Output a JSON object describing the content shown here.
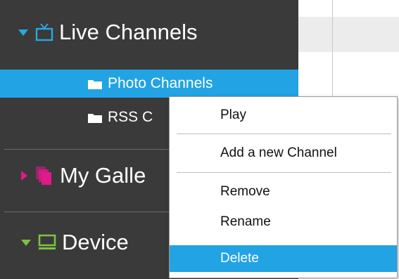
{
  "sidebar": {
    "sections": [
      {
        "label": "Live Channels",
        "icon": "tv-icon",
        "expanded": true,
        "color": "#29a8e0"
      },
      {
        "label": "My Galle",
        "icon": "gallery-icon",
        "expanded": false,
        "color": "#e0198c"
      },
      {
        "label": "Device",
        "icon": "monitor-icon",
        "expanded": true,
        "color": "#7cc242"
      }
    ],
    "live_channels_items": [
      {
        "label": "Photo Channels",
        "icon": "folder-icon",
        "selected": true
      },
      {
        "label": "RSS C",
        "icon": "folder-icon",
        "selected": false
      }
    ]
  },
  "context_menu": {
    "items": [
      {
        "label": "Play"
      },
      {
        "label": "Add a new Channel"
      },
      {
        "label": "Remove"
      },
      {
        "label": "Rename"
      },
      {
        "label": "Delete",
        "highlighted": true
      }
    ]
  },
  "colors": {
    "sidebar_bg": "#3a3a3a",
    "selection": "#22a3e3",
    "live_accent": "#29a8e0",
    "gallery_accent": "#e0198c",
    "device_accent": "#7cc242"
  }
}
